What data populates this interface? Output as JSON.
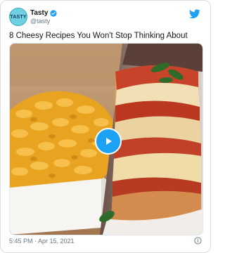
{
  "tweet": {
    "author_name": "Tasty",
    "author_handle": "@tasty",
    "avatar_text": "TASTY",
    "text": "8 Cheesy Recipes You Won't Stop Thinking About",
    "timestamp": "5:45 PM · Apr 15, 2021"
  },
  "colors": {
    "brand": "#1da1f2",
    "text": "#14171a",
    "muted": "#657786"
  },
  "icons": {
    "verified": "verified-badge-icon",
    "logo": "twitter-bird-icon",
    "play": "play-icon",
    "info": "info-icon"
  }
}
